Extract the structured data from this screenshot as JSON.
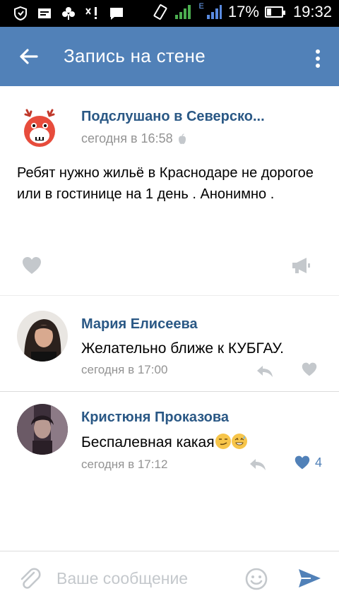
{
  "status_bar": {
    "battery_percent": "17%",
    "time": "19:32",
    "network_type": "E"
  },
  "header": {
    "title": "Запись на стене"
  },
  "post": {
    "author": "Подслушано в Северско...",
    "time": "сегодня в 16:58",
    "text": "Ребят нужно жильё в Краснодаре не дорогое или в гостинице на 1 день . Анонимно ."
  },
  "comments": [
    {
      "author": "Мария Елисеева",
      "text": "Желательно ближе к КУБГАУ.",
      "time": "сегодня в 17:00",
      "likes": ""
    },
    {
      "author": "Кристюня Проказова",
      "text": "Беспалевная какая",
      "time": "сегодня в 17:12",
      "likes": "4"
    }
  ],
  "composer": {
    "placeholder": "Ваше сообщение"
  },
  "colors": {
    "header_bg": "#5181b8",
    "author_link": "#2a5885",
    "meta_gray": "#939393",
    "icon_gray": "#c4c8cc",
    "liked_blue": "#5181b8"
  }
}
